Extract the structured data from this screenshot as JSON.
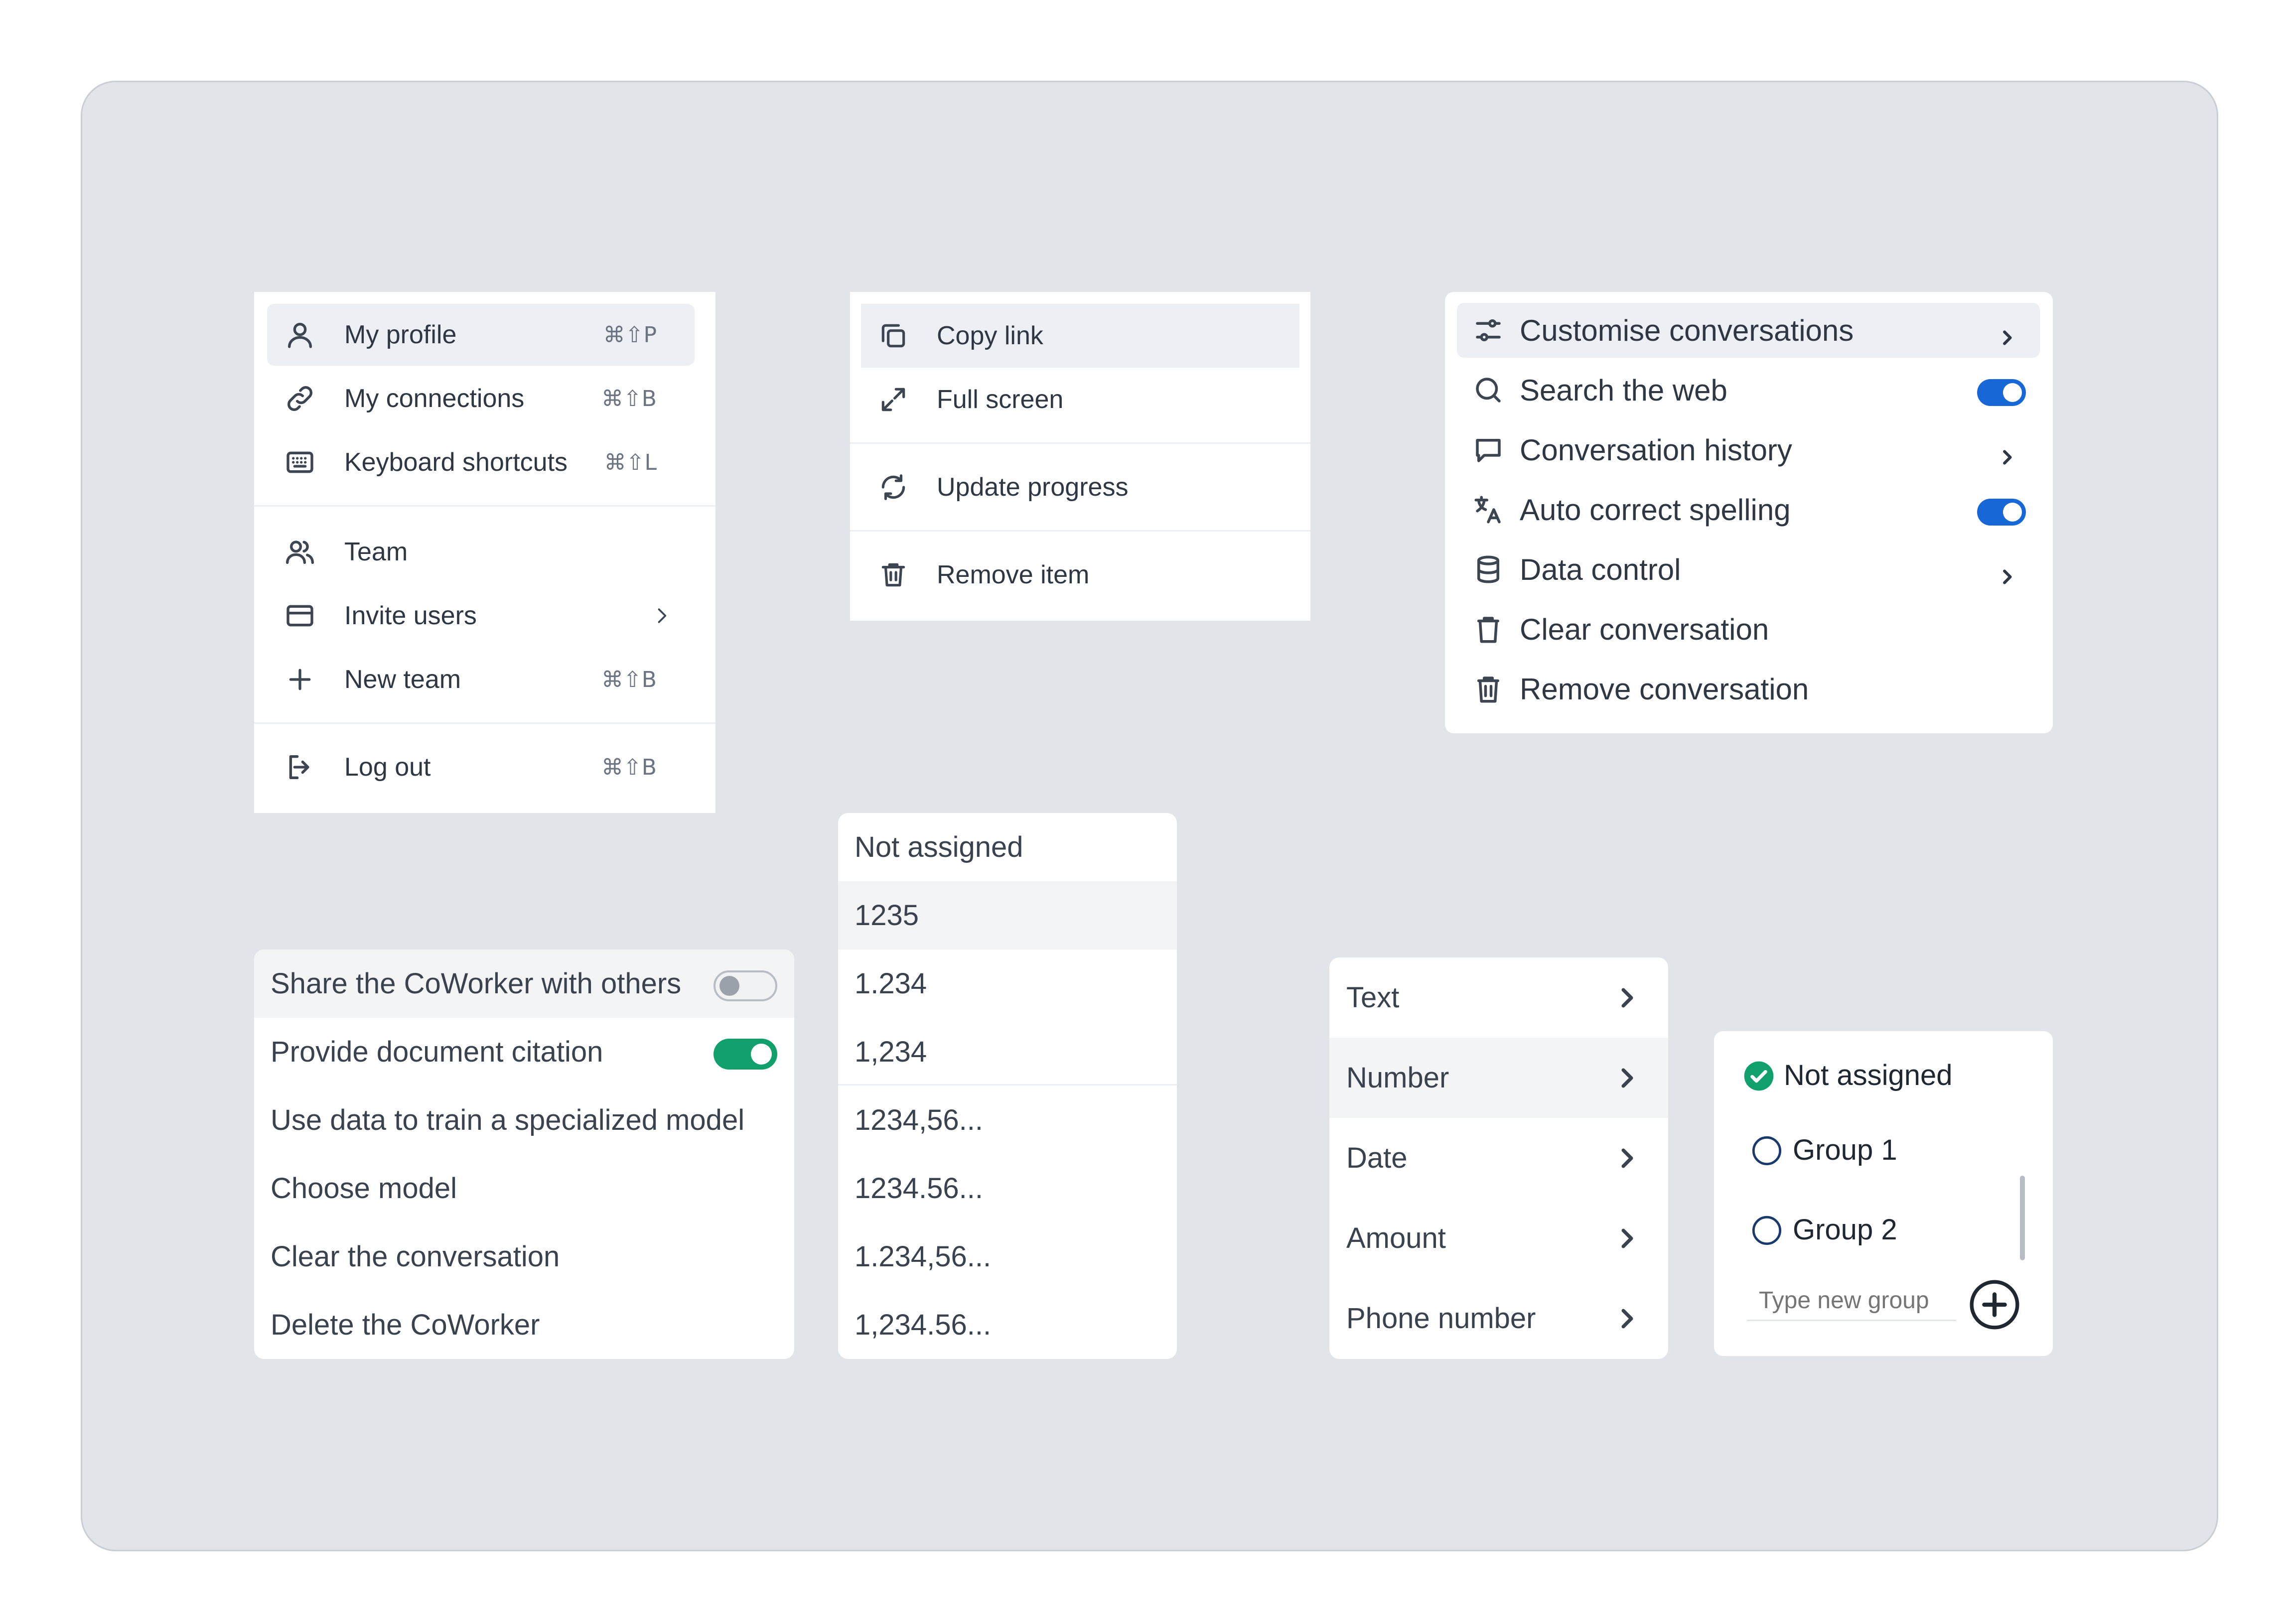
{
  "colors": {
    "canvas": "#e1e5e9",
    "toggle_blue": "#1767d6",
    "toggle_green": "#11a06b",
    "selected_row": "#f2f4f6",
    "check_green": "#11a06b",
    "radio_outline": "#1a3a6e"
  },
  "account_menu": {
    "items": [
      {
        "label": "My profile",
        "shortcut": "⌘⇧P",
        "icon": "user-icon"
      },
      {
        "label": "My connections",
        "shortcut": "⌘⇧B",
        "icon": "link-icon"
      },
      {
        "label": "Keyboard shortcuts",
        "shortcut": "⌘⇧L",
        "icon": "keyboard-icon"
      },
      {
        "label": "Team",
        "icon": "users-icon"
      },
      {
        "label": "Invite users",
        "icon": "card-icon"
      },
      {
        "label": "New team",
        "shortcut": "⌘⇧B",
        "icon": "plus-icon"
      },
      {
        "label": "Log out",
        "shortcut": "⌘⇧B",
        "icon": "logout-icon"
      }
    ]
  },
  "item_menu": {
    "items": [
      {
        "label": "Copy link",
        "icon": "copy-icon"
      },
      {
        "label": "Full screen",
        "icon": "expand-icon"
      },
      {
        "label": "Update progress",
        "icon": "refresh-icon"
      },
      {
        "label": "Remove item",
        "icon": "trash-icon"
      }
    ]
  },
  "conversation_menu": {
    "items": [
      {
        "label": "Customise conversations",
        "icon": "sliders-icon"
      },
      {
        "label": "Search the web",
        "icon": "search-icon",
        "toggle": true
      },
      {
        "label": "Conversation history",
        "icon": "message-icon"
      },
      {
        "label": "Auto correct spelling",
        "icon": "translate-icon",
        "toggle": true
      },
      {
        "label": "Data control",
        "icon": "database-icon"
      },
      {
        "label": "Clear conversation",
        "icon": "trash-icon"
      },
      {
        "label": "Remove conversation",
        "icon": "trash-full-icon"
      }
    ]
  },
  "coworker_menu": {
    "items": [
      {
        "label": "Share the CoWorker with others",
        "toggle": false
      },
      {
        "label": "Provide document citation",
        "toggle": true
      },
      {
        "label": "Use data to train a specialized model"
      },
      {
        "label": "Choose model"
      },
      {
        "label": "Clear the conversation"
      },
      {
        "label": "Delete the CoWorker"
      }
    ]
  },
  "number_format_menu": {
    "items": [
      "Not assigned",
      "1235",
      "1.234",
      "1,234",
      "1234,56...",
      "1234.56...",
      "1.234,56...",
      "1,234.56..."
    ]
  },
  "field_type_menu": {
    "items": [
      "Text",
      "Number",
      "Date",
      "Amount",
      "Phone number"
    ]
  },
  "group_menu": {
    "selected": "Not assigned",
    "options": [
      "Group 1",
      "Group 2"
    ],
    "new_group_placeholder": "Type new group"
  }
}
